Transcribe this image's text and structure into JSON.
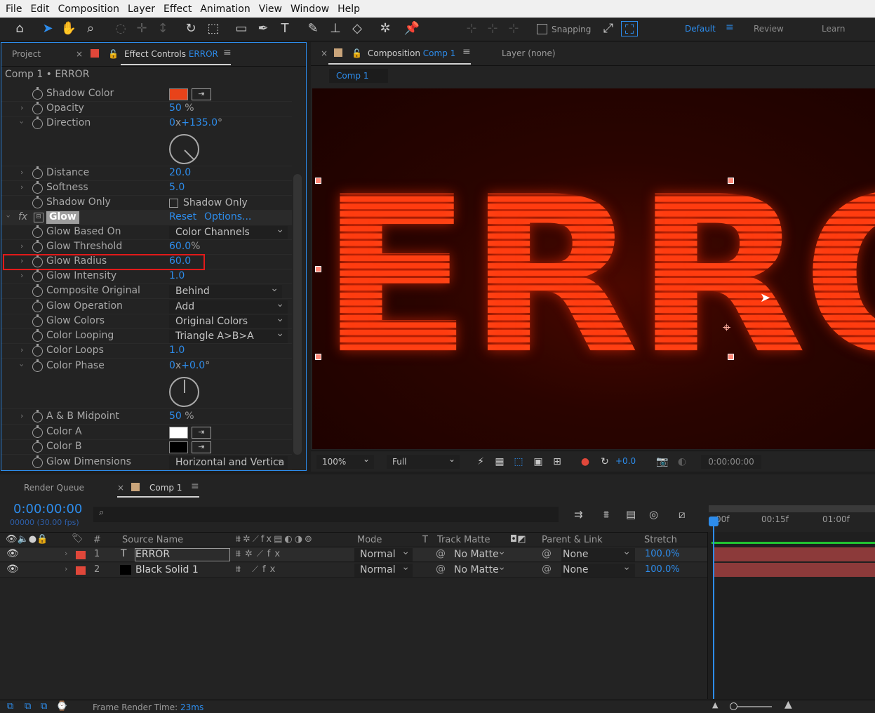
{
  "menu": [
    "File",
    "Edit",
    "Composition",
    "Layer",
    "Effect",
    "Animation",
    "View",
    "Window",
    "Help"
  ],
  "toolbar": {
    "snapping_label": "Snapping",
    "workspaces": [
      "Default",
      "Review",
      "Learn"
    ]
  },
  "left_panel": {
    "tab_project": "Project",
    "tab_effect_controls": "Effect Controls",
    "tab_effect_layer": "ERROR",
    "breadcrumb": "Comp 1 • ERROR",
    "rows": {
      "shadow_color": {
        "label": "Shadow Color",
        "color": "#e8431a"
      },
      "opacity": {
        "label": "Opacity",
        "value": "50",
        "unit": "%"
      },
      "direction": {
        "label": "Direction",
        "value": "0",
        "mid": "x",
        "value2": "+135.0",
        "unit": "°"
      },
      "distance": {
        "label": "Distance",
        "value": "20.0"
      },
      "softness": {
        "label": "Softness",
        "value": "5.0"
      },
      "shadow_only": {
        "label": "Shadow Only",
        "checkbox": "Shadow Only"
      },
      "glow": {
        "label": "Glow",
        "reset": "Reset",
        "options": "Options..."
      },
      "glow_based_on": {
        "label": "Glow Based On",
        "value": "Color Channels"
      },
      "glow_threshold": {
        "label": "Glow Threshold",
        "value": "60.0",
        "unit": "%"
      },
      "glow_radius": {
        "label": "Glow Radius",
        "value": "60.0"
      },
      "glow_intensity": {
        "label": "Glow Intensity",
        "value": "1.0"
      },
      "composite_original": {
        "label": "Composite Original",
        "value": "Behind"
      },
      "glow_operation": {
        "label": "Glow Operation",
        "value": "Add"
      },
      "glow_colors": {
        "label": "Glow Colors",
        "value": "Original Colors"
      },
      "color_looping": {
        "label": "Color Looping",
        "value": "Triangle A>B>A"
      },
      "color_loops": {
        "label": "Color Loops",
        "value": "1.0"
      },
      "color_phase": {
        "label": "Color Phase",
        "value": "0",
        "mid": "x",
        "value2": "+0.0",
        "unit": "°"
      },
      "ab_midpoint": {
        "label": "A & B Midpoint",
        "value": "50",
        "unit": "%"
      },
      "color_a": {
        "label": "Color A",
        "color": "#ffffff"
      },
      "color_b": {
        "label": "Color B",
        "color": "#000000"
      },
      "glow_dimensions": {
        "label": "Glow Dimensions",
        "value": "Horizontal and Vertica"
      }
    }
  },
  "comp_panel": {
    "tab_label": "Composition",
    "tab_comp": "Comp 1",
    "layer_tab": "Layer (none)",
    "subtab": "Comp 1",
    "viewer_text": "ERRO",
    "zoom": "100%",
    "resolution": "Full",
    "exposure": "+0.0",
    "timecode": "0:00:00:00"
  },
  "timeline": {
    "tab_render_queue": "Render Queue",
    "tab_comp": "Comp 1",
    "current_time": "0:00:00:00",
    "frames": "00000 (30.00 fps)",
    "ruler": [
      "00f",
      "00:15f",
      "01:00f"
    ],
    "headers": {
      "num": "#",
      "source": "Source Name",
      "mode": "Mode",
      "t": "T",
      "track_matte": "Track Matte",
      "parent": "Parent & Link",
      "stretch": "Stretch"
    },
    "layers": [
      {
        "num": "1",
        "type": "T",
        "name": "ERROR",
        "mode": "Normal",
        "matte": "No Matte",
        "parent": "None",
        "stretch": "100.0%",
        "label_color": "#e0473a"
      },
      {
        "num": "2",
        "type": "■",
        "name": "Black Solid 1",
        "mode": "Normal",
        "matte": "No Matte",
        "parent": "None",
        "stretch": "100.0%",
        "label_color": "#e0473a"
      }
    ]
  },
  "status": {
    "frame_render_label": "Frame Render Time:",
    "frame_render_value": "23ms"
  }
}
